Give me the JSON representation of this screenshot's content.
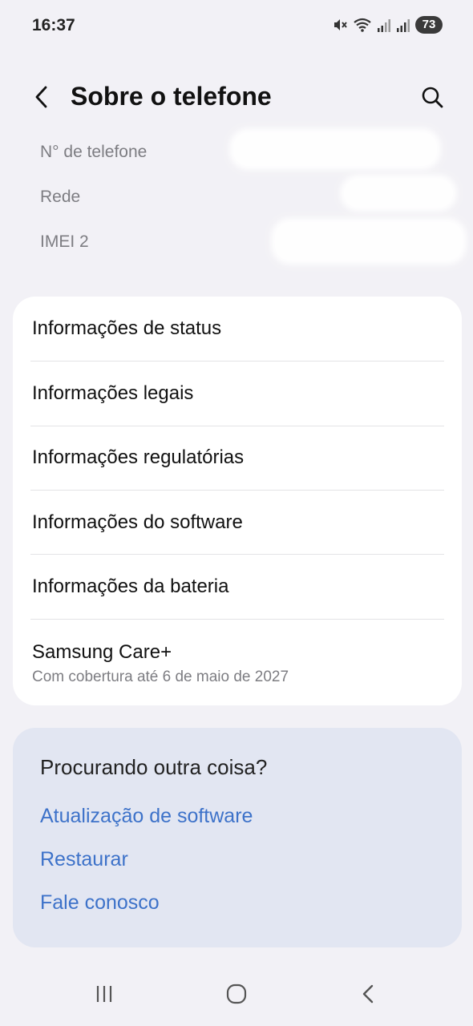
{
  "status_bar": {
    "time": "16:37",
    "battery": "73",
    "icons": [
      "mute-icon",
      "wifi-icon",
      "signal-icon",
      "signal-icon"
    ]
  },
  "header": {
    "title": "Sobre o telefone",
    "back_icon": "chevron-left-icon",
    "search_icon": "search-icon"
  },
  "info_rows": [
    {
      "label": "N° de telefone"
    },
    {
      "label": "Rede"
    },
    {
      "label": "IMEI 2"
    }
  ],
  "menu": {
    "items": [
      {
        "label": "Informações de status"
      },
      {
        "label": "Informações legais"
      },
      {
        "label": "Informações regulatórias"
      },
      {
        "label": "Informações do software"
      },
      {
        "label": "Informações da bateria"
      },
      {
        "label": "Samsung Care+",
        "sub": "Com cobertura até 6 de maio de 2027"
      }
    ]
  },
  "suggestions": {
    "title": "Procurando outra coisa?",
    "links": [
      {
        "label": "Atualização de software"
      },
      {
        "label": "Restaurar"
      },
      {
        "label": "Fale conosco"
      }
    ],
    "link_color": "#3d72c9"
  },
  "nav_bar": {
    "recents_icon": "recents-icon",
    "home_icon": "home-icon",
    "back_icon": "back-icon"
  }
}
